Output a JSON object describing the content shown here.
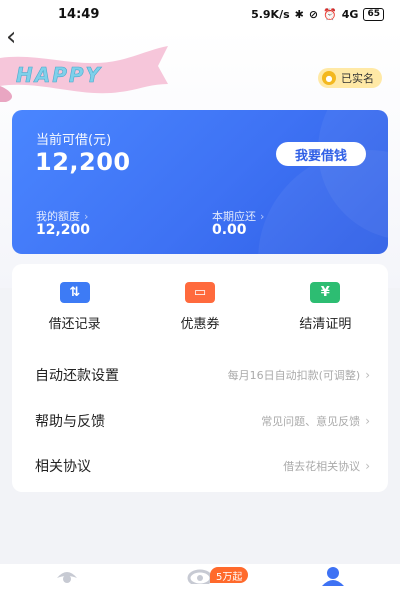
{
  "status_bar": {
    "time": "14:49",
    "network_speed": "5.9K/s",
    "signal": "4G",
    "battery": "65"
  },
  "header": {
    "back_icon": "chevron-left-icon",
    "banner_text": "HAPPY",
    "verified_label": "已实名"
  },
  "card": {
    "available_label": "当前可借(元)",
    "available_amount": "12,200",
    "borrow_button": "我要借钱",
    "quota_label": "我的额度",
    "quota_value": "12,200",
    "due_label": "本期应还",
    "due_value": "0.00"
  },
  "shortcuts": [
    {
      "label": "借还记录",
      "icon": "exchange-icon",
      "color": "#3d7bf5"
    },
    {
      "label": "优惠券",
      "icon": "coupon-icon",
      "color": "#ff6a3d"
    },
    {
      "label": "结清证明",
      "icon": "yen-certificate-icon",
      "color": "#2dbd72"
    }
  ],
  "settings": [
    {
      "title": "自动还款设置",
      "hint": "每月16日自动扣款(可调整)"
    },
    {
      "title": "帮助与反馈",
      "hint": "常见问题、意见反馈"
    },
    {
      "title": "相关协议",
      "hint": "借去花相关协议"
    }
  ],
  "tabbar": {
    "badge": "5万起",
    "tabs": [
      "home-icon",
      "eye-icon",
      "profile-icon"
    ]
  },
  "colors": {
    "accent": "#3e72f4",
    "badge": "#ff6a2c",
    "verified_bg": "#ffe9a6"
  }
}
